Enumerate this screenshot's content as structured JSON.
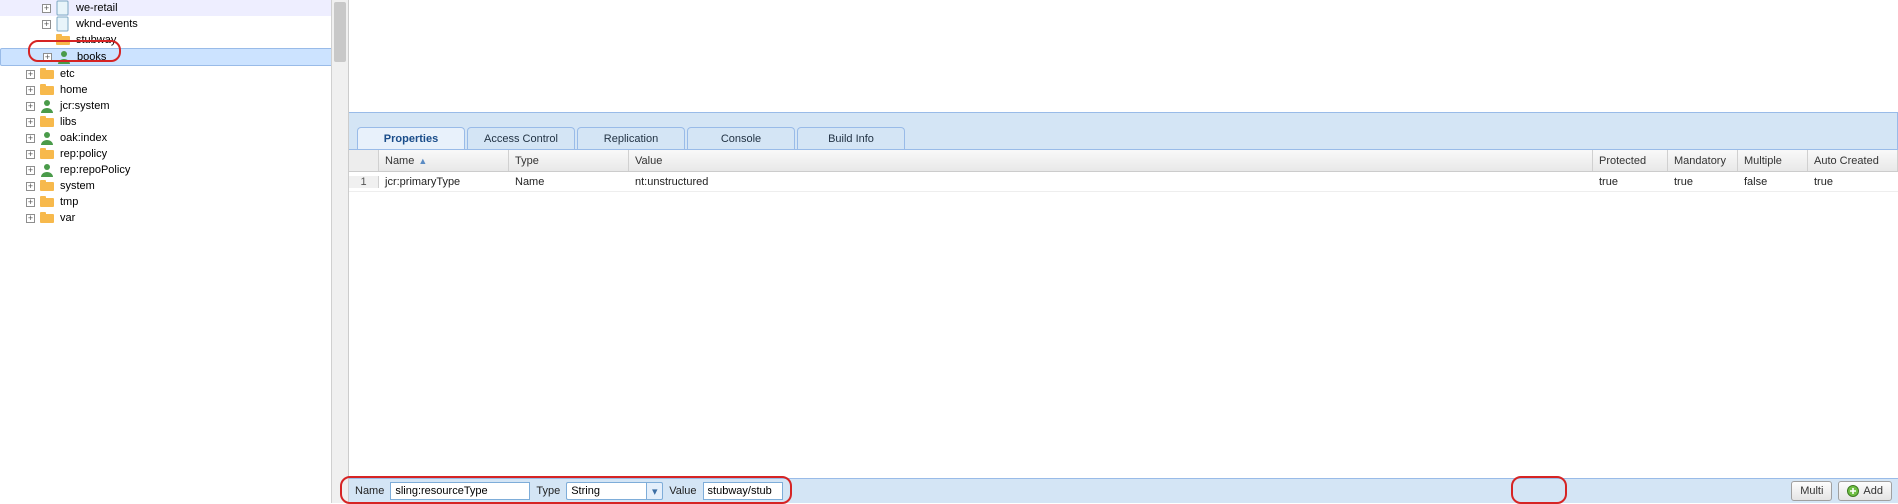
{
  "tree": {
    "nodes": [
      {
        "indent": 42,
        "toggle": "plus",
        "icon": "page",
        "label": "we-retail"
      },
      {
        "indent": 42,
        "toggle": "plus",
        "icon": "page",
        "label": "wknd-events"
      },
      {
        "indent": 42,
        "toggle": null,
        "icon": "folder",
        "label": "stubway"
      },
      {
        "indent": 42,
        "toggle": "plus",
        "icon": "user",
        "label": "books",
        "selected": true,
        "annot": true
      },
      {
        "indent": 26,
        "toggle": "plus",
        "icon": "folder",
        "label": "etc"
      },
      {
        "indent": 26,
        "toggle": "plus",
        "icon": "folder",
        "label": "home"
      },
      {
        "indent": 26,
        "toggle": "plus",
        "icon": "user",
        "label": "jcr:system"
      },
      {
        "indent": 26,
        "toggle": "plus",
        "icon": "folder",
        "label": "libs"
      },
      {
        "indent": 26,
        "toggle": "plus",
        "icon": "user",
        "label": "oak:index"
      },
      {
        "indent": 26,
        "toggle": "plus",
        "icon": "folder",
        "label": "rep:policy"
      },
      {
        "indent": 26,
        "toggle": "plus",
        "icon": "user",
        "label": "rep:repoPolicy"
      },
      {
        "indent": 26,
        "toggle": "plus",
        "icon": "folder",
        "label": "system"
      },
      {
        "indent": 26,
        "toggle": "plus",
        "icon": "folder",
        "label": "tmp"
      },
      {
        "indent": 26,
        "toggle": "plus",
        "icon": "folder",
        "label": "var"
      }
    ]
  },
  "tabs": [
    {
      "label": "Properties",
      "active": true
    },
    {
      "label": "Access Control"
    },
    {
      "label": "Replication"
    },
    {
      "label": "Console"
    },
    {
      "label": "Build Info"
    }
  ],
  "grid": {
    "headers": {
      "name": "Name",
      "type": "Type",
      "value": "Value",
      "protected": "Protected",
      "mandatory": "Mandatory",
      "multiple": "Multiple",
      "auto": "Auto Created"
    },
    "rows": [
      {
        "num": "1",
        "name": "jcr:primaryType",
        "type": "Name",
        "value": "nt:unstructured",
        "protected": "true",
        "mandatory": "true",
        "multiple": "false",
        "auto": "true"
      }
    ]
  },
  "bottom": {
    "name_label": "Name",
    "name_value": "sling:resourceType",
    "type_label": "Type",
    "type_value": "String",
    "value_label": "Value",
    "value_value": "stubway/stub",
    "multi_label": "Multi",
    "add_label": "Add"
  }
}
